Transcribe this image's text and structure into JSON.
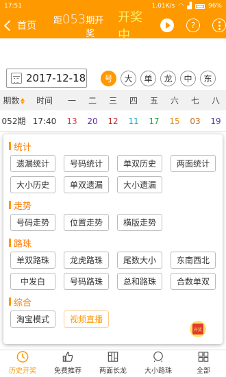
{
  "statusbar": {
    "time": "17:51",
    "speed": "1.01K/s",
    "battery": "96%"
  },
  "header": {
    "back_label": "首页",
    "issue_prefix": "距",
    "issue_number": "053",
    "issue_suffix": "期开奖",
    "drawing_status": "开奖中",
    "help_label": "?"
  },
  "date_filter": {
    "date": "2017-12-18",
    "chips": [
      {
        "label": "号",
        "active": true
      },
      {
        "label": "大",
        "active": false
      },
      {
        "label": "单",
        "active": false
      },
      {
        "label": "龙",
        "active": false
      },
      {
        "label": "中",
        "active": false
      },
      {
        "label": "东",
        "active": false
      }
    ]
  },
  "table": {
    "headers": [
      "期数",
      "时间",
      "一",
      "二",
      "三",
      "四",
      "五",
      "六",
      "七",
      "八"
    ],
    "row": {
      "issue": "052期",
      "time": "17:40",
      "numbers": [
        "13",
        "20",
        "12",
        "11",
        "17",
        "15",
        "03",
        "19"
      ]
    }
  },
  "menu": {
    "sections": [
      {
        "title": "统计",
        "items": [
          "遗漏统计",
          "号码统计",
          "单双历史",
          "两面统计",
          "大小历史",
          "单双遗漏",
          "大小遗漏"
        ]
      },
      {
        "title": "走势",
        "items": [
          "号码走势",
          "位置走势",
          "横版走势"
        ]
      },
      {
        "title": "路珠",
        "items": [
          "单双路珠",
          "龙虎路珠",
          "尾数大小",
          "东南西北",
          "中发白",
          "号码路珠",
          "总和路珠",
          "合数单双"
        ]
      },
      {
        "title": "综合",
        "items": [
          "淘宝模式",
          "视频直播"
        ]
      }
    ],
    "badge_label": "开奖"
  },
  "bottom_nav": [
    {
      "label": "历史开奖",
      "icon": "clock-icon",
      "active": true
    },
    {
      "label": "免费推荐",
      "icon": "thumbs-up-icon",
      "active": false
    },
    {
      "label": "两面长龙",
      "icon": "columns-icon",
      "active": false
    },
    {
      "label": "大小路珠",
      "icon": "ball-icon",
      "active": false
    },
    {
      "label": "全部",
      "icon": "grid-icon",
      "active": false
    }
  ],
  "colors": {
    "accent": "#ff9900",
    "highlight": "#fff06a"
  }
}
